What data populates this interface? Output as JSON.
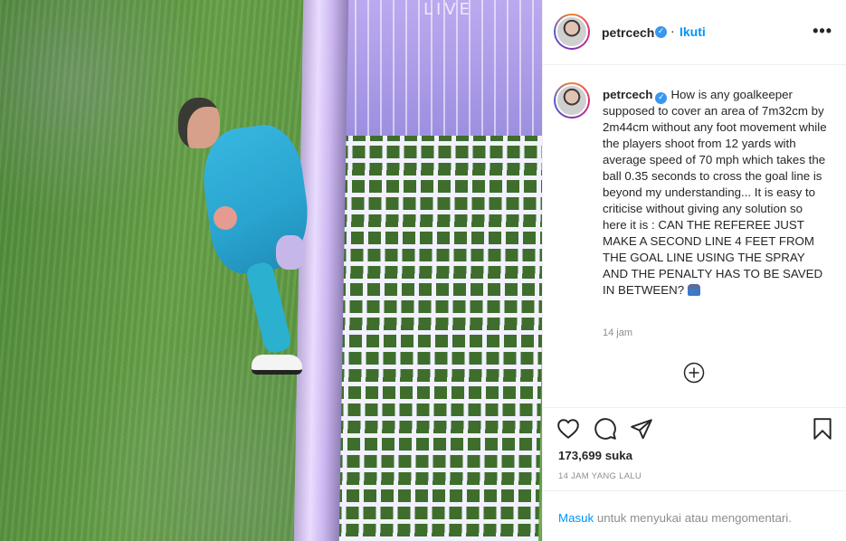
{
  "post": {
    "overlay_text": "LIVE",
    "author": {
      "username": "petrcech",
      "verified_icon": "✓",
      "follow_label": "Ikuti"
    },
    "more_label": "•••",
    "caption": "How is any goalkeeper supposed to cover an area of 7m32cm by 2m44cm without any foot movement while the players shoot from 12 yards with average speed of 70 mph which takes the ball 0.35 seconds to cross the goal line is beyond my understanding... It is easy to criticise without giving any solution so here it is : CAN THE REFEREE JUST MAKE A SECOND LINE 4 FEET FROM THE GOAL LINE USING THE SPRAY AND THE PENALTY HAS TO BE SAVED IN BETWEEN?",
    "caption_time": "14 jam",
    "likes": "173,699 suka",
    "timestamp": "14 JAM YANG LALU",
    "login": {
      "link": "Masuk",
      "text": " untuk menyukai atau mengomentari."
    }
  },
  "icons": {
    "add_comment": "plus-circle-icon",
    "like": "heart-icon",
    "comment": "comment-bubble-icon",
    "share": "paper-plane-icon",
    "save": "bookmark-icon",
    "emoji": "person-shrugging-emoji"
  },
  "colors": {
    "link_blue": "#0095f6",
    "verified_blue": "#3897f0",
    "text_dark": "#262626",
    "text_grey": "#8e8e8e",
    "divider": "#efefef"
  }
}
